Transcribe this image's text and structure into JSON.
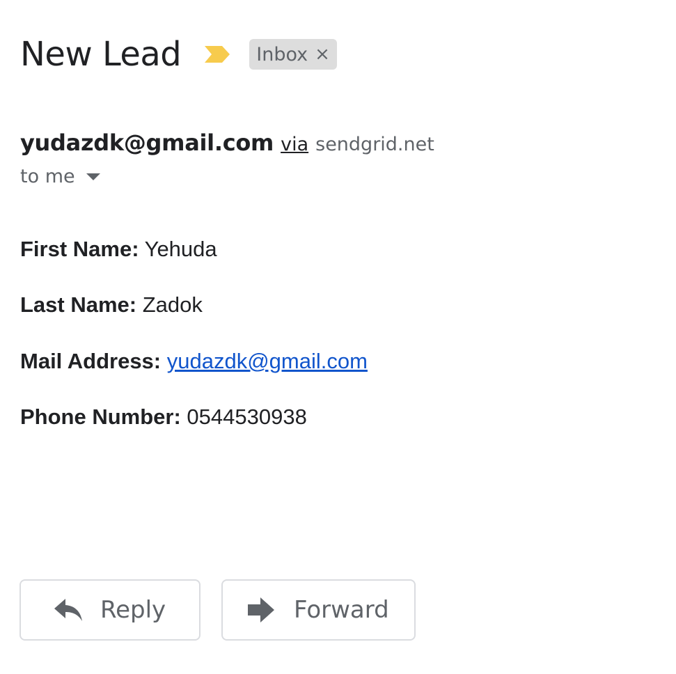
{
  "email": {
    "subject": "New Lead",
    "importance_icon": "importance-marker-icon",
    "label": {
      "name": "Inbox",
      "close_glyph": "×"
    },
    "sender": {
      "email": "yudazdk@gmail.com",
      "via_label": "via",
      "via_domain": "sendgrid.net"
    },
    "recipient": {
      "text": "to me",
      "dropdown_icon": "caret-down-icon"
    },
    "body": {
      "fields": [
        {
          "label": "First Name:",
          "value": "Yehuda"
        },
        {
          "label": "Last Name:",
          "value": "Zadok"
        },
        {
          "label": "Mail Address:",
          "value": "yudazdk@gmail.com"
        },
        {
          "label": "Phone Number:",
          "value": "0544530938"
        }
      ]
    },
    "actions": {
      "reply_label": "Reply",
      "reply_icon": "reply-arrow-icon",
      "forward_label": "Forward",
      "forward_icon": "forward-arrow-icon"
    }
  },
  "colors": {
    "text_primary": "#202124",
    "text_secondary": "#5f6368",
    "importance": "#f7cb4d",
    "chip_background": "#dddddd",
    "link": "#1155cc",
    "button_border": "#dadce0"
  }
}
